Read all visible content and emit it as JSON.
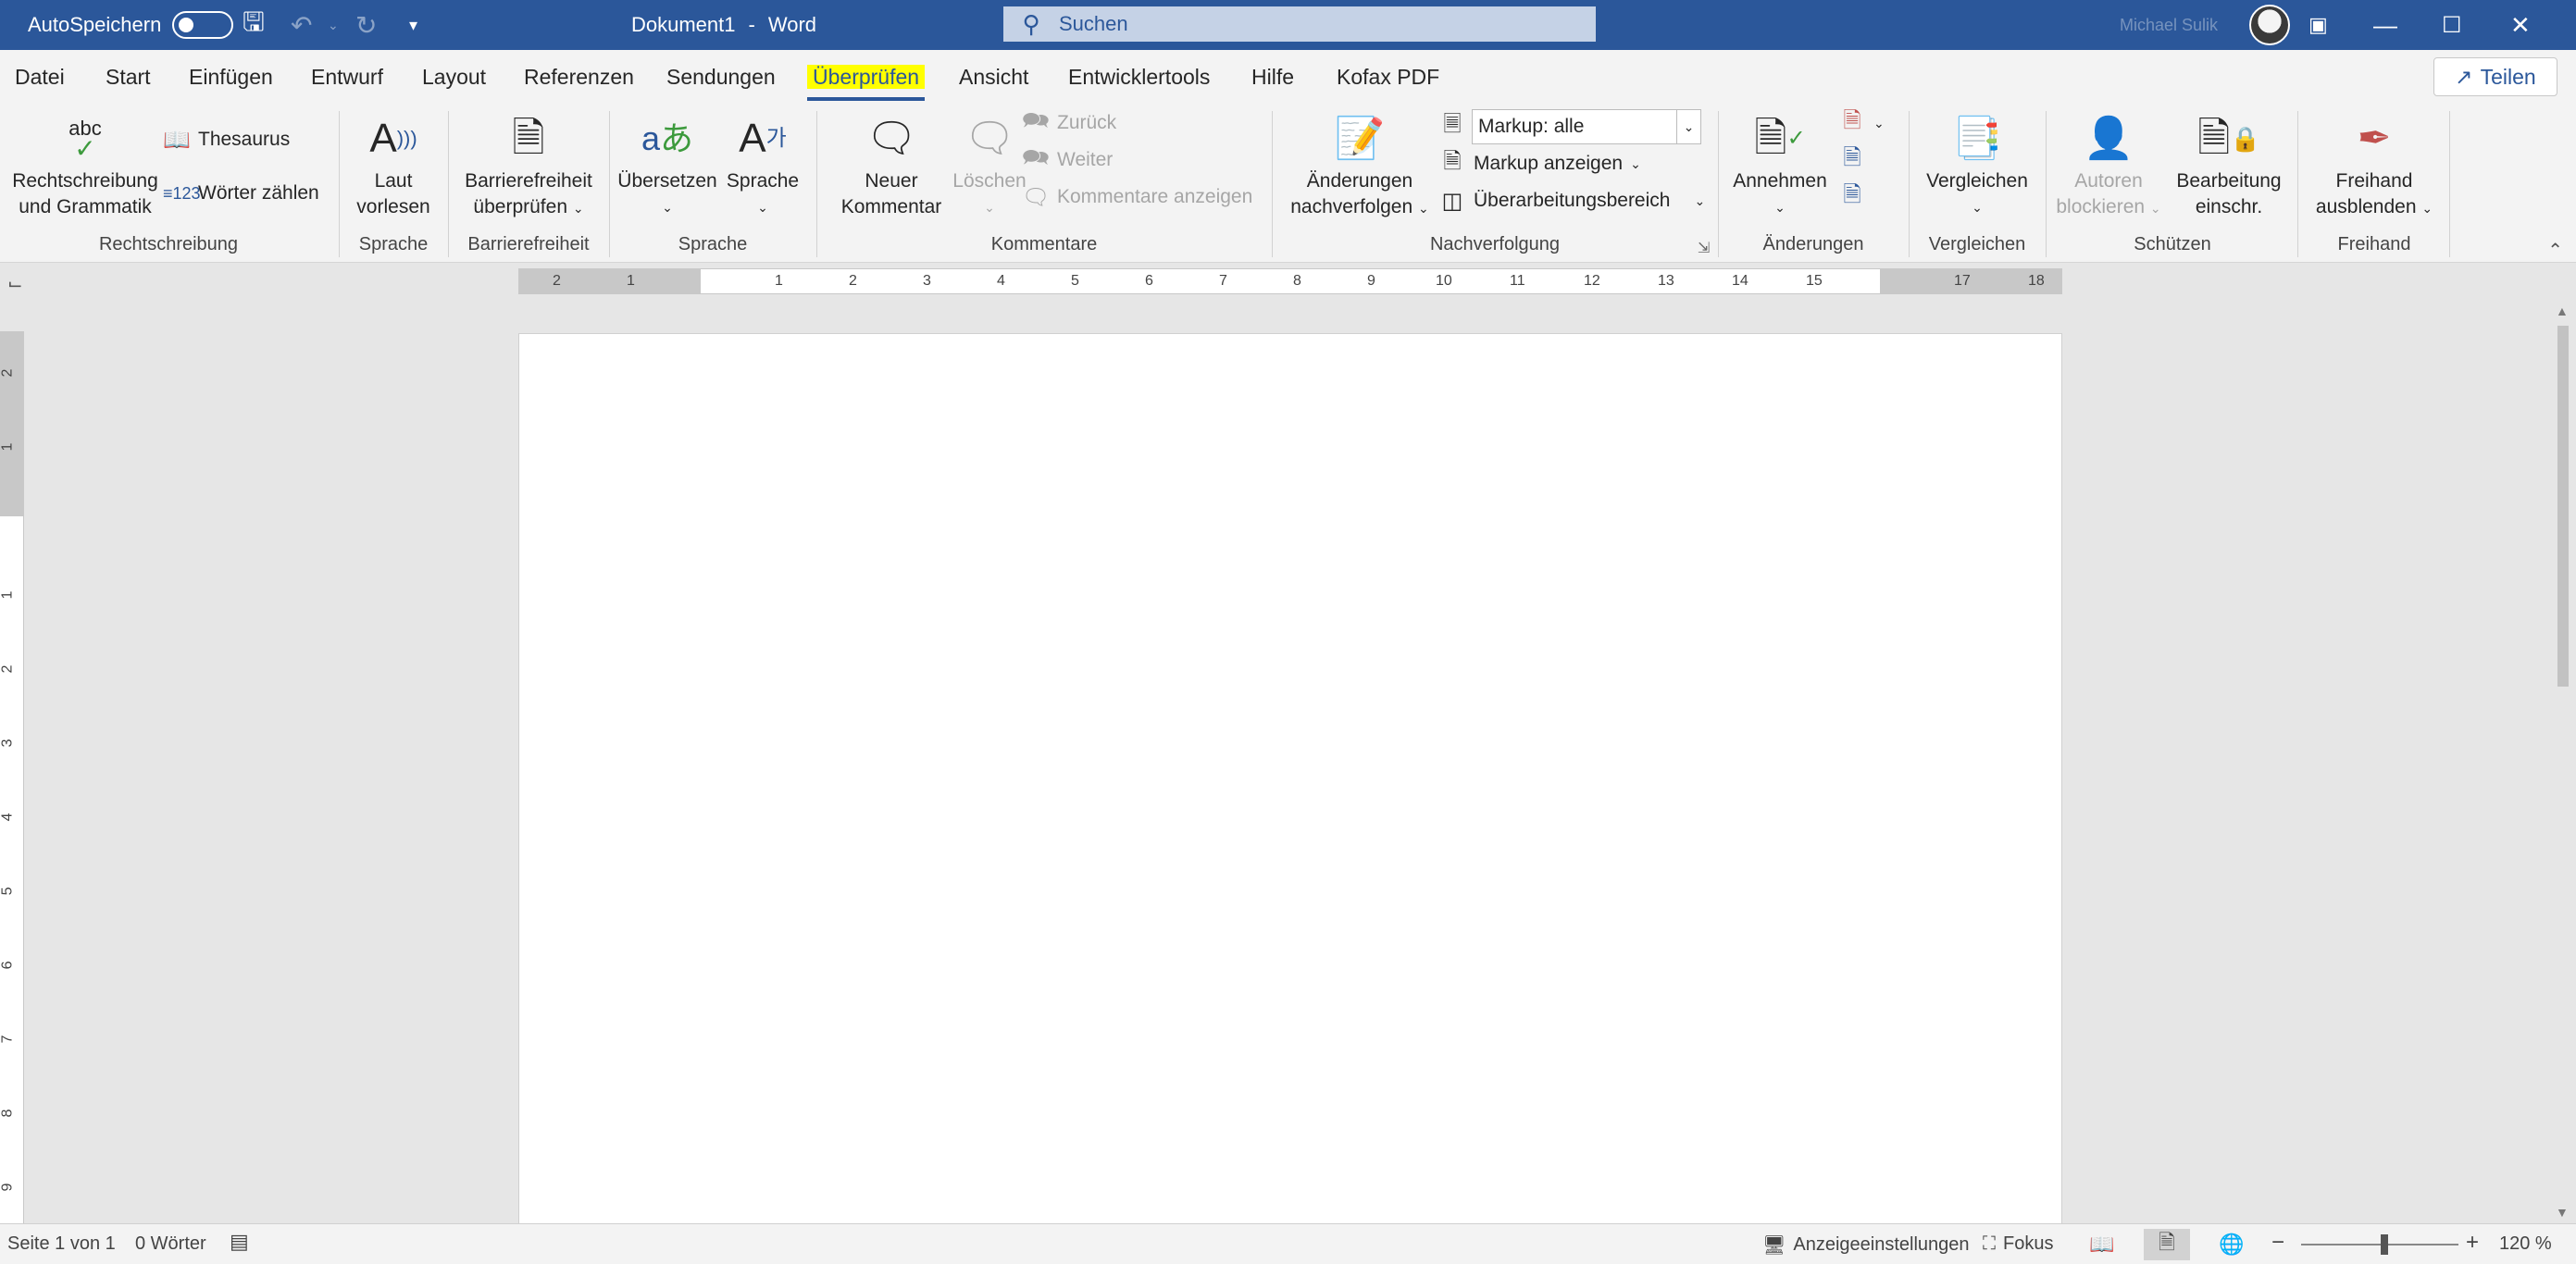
{
  "titlebar": {
    "autosave_label": "AutoSpeichern",
    "document_title": "Dokument1",
    "title_separator": "-",
    "app_name": "Word",
    "search_placeholder": "Suchen",
    "user_name": "Michael Sulik"
  },
  "menu": {
    "tabs": [
      "Datei",
      "Start",
      "Einfügen",
      "Entwurf",
      "Layout",
      "Referenzen",
      "Sendungen",
      "Überprüfen",
      "Ansicht",
      "Entwicklertools",
      "Hilfe",
      "Kofax PDF"
    ],
    "active": "Überprüfen",
    "share_label": "Teilen"
  },
  "ribbon": {
    "rechtschreibung": {
      "label": "Rechtschreibung",
      "spelling_line1": "Rechtschreibung",
      "spelling_line2": "und Grammatik",
      "spelling_icon_text": "abc",
      "thesaurus": "Thesaurus",
      "word_count": "Wörter zählen"
    },
    "sprache_read": {
      "label": "Sprache",
      "read_line1": "Laut",
      "read_line2": "vorlesen"
    },
    "barrierefreiheit": {
      "label": "Barrierefreiheit",
      "check_line1": "Barrierefreiheit",
      "check_line2": "überprüfen"
    },
    "sprache": {
      "label": "Sprache",
      "translate": "Übersetzen",
      "language": "Sprache"
    },
    "kommentare": {
      "label": "Kommentare",
      "new_line1": "Neuer",
      "new_line2": "Kommentar",
      "delete": "Löschen",
      "back": "Zurück",
      "next": "Weiter",
      "show": "Kommentare anzeigen"
    },
    "nachverfolgung": {
      "label": "Nachverfolgung",
      "track_line1": "Änderungen",
      "track_line2": "nachverfolgen",
      "markup_value": "Markup: alle",
      "show_markup": "Markup anzeigen",
      "review_pane": "Überarbeitungsbereich"
    },
    "aenderungen": {
      "label": "Änderungen",
      "accept": "Annehmen"
    },
    "vergleichen": {
      "label": "Vergleichen",
      "compare": "Vergleichen"
    },
    "schuetzen": {
      "label": "Schützen",
      "block_line1": "Autoren",
      "block_line2": "blockieren",
      "restrict_line1": "Bearbeitung",
      "restrict_line2": "einschr."
    },
    "freihand": {
      "label": "Freihand",
      "hide_line1": "Freihand",
      "hide_line2": "ausblenden"
    }
  },
  "ruler": {
    "left_ticks": [
      "2",
      "1"
    ],
    "ticks": [
      "1",
      "2",
      "3",
      "4",
      "5",
      "6",
      "7",
      "8",
      "9",
      "10",
      "11",
      "12",
      "13",
      "14",
      "15",
      "17",
      "18"
    ],
    "vertical_top": [
      "2",
      "1"
    ],
    "vertical": [
      "1",
      "2",
      "3",
      "4",
      "5",
      "6",
      "7",
      "8",
      "9"
    ]
  },
  "statusbar": {
    "page_info": "Seite 1 von 1",
    "word_count": "0 Wörter",
    "display_settings": "Anzeigeeinstellungen",
    "focus": "Fokus",
    "zoom_minus": "−",
    "zoom_plus": "+",
    "zoom_level": "120 %"
  },
  "colors": {
    "accent": "#2b579a",
    "highlight": "#ffff00"
  }
}
